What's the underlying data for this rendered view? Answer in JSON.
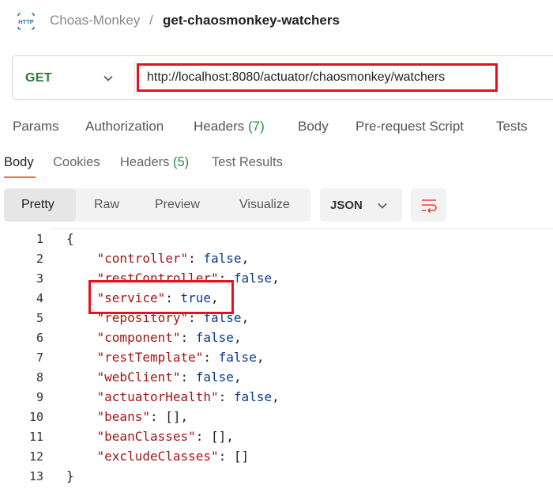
{
  "header": {
    "icon": "http-icon",
    "icon_text": "HTTP",
    "collection": "Choas-Monkey",
    "separator": "/",
    "request_name": "get-chaosmonkey-watchers"
  },
  "request": {
    "method": "GET",
    "url": "http://localhost:8080/actuator/chaosmonkey/watchers"
  },
  "request_tabs": [
    {
      "label": "Params"
    },
    {
      "label": "Authorization"
    },
    {
      "label": "Headers",
      "count": "(7)"
    },
    {
      "label": "Body"
    },
    {
      "label": "Pre-request Script"
    },
    {
      "label": "Tests"
    }
  ],
  "response_tabs": [
    {
      "label": "Body",
      "active": true
    },
    {
      "label": "Cookies"
    },
    {
      "label": "Headers",
      "count": "(5)"
    },
    {
      "label": "Test Results"
    }
  ],
  "view_modes": [
    "Pretty",
    "Raw",
    "Preview",
    "Visualize"
  ],
  "active_view_mode": "Pretty",
  "format": "JSON",
  "code": {
    "line_numbers": [
      "1",
      "2",
      "3",
      "4",
      "5",
      "6",
      "7",
      "8",
      "9",
      "10",
      "11",
      "12",
      "13"
    ],
    "open_brace": "{",
    "close_brace": "}",
    "entries": [
      {
        "key": "\"controller\"",
        "value": "false",
        "tail": ","
      },
      {
        "key": "\"restController\"",
        "value": "false",
        "tail": ","
      },
      {
        "key": "\"service\"",
        "value": "true",
        "tail": ","
      },
      {
        "key": "\"repository\"",
        "value": "false",
        "tail": ","
      },
      {
        "key": "\"component\"",
        "value": "false",
        "tail": ","
      },
      {
        "key": "\"restTemplate\"",
        "value": "false",
        "tail": ","
      },
      {
        "key": "\"webClient\"",
        "value": "false",
        "tail": ","
      },
      {
        "key": "\"actuatorHealth\"",
        "value": "false",
        "tail": ","
      },
      {
        "key": "\"beans\"",
        "value": "[]",
        "tail": ","
      },
      {
        "key": "\"beanClasses\"",
        "value": "[]",
        "tail": ","
      },
      {
        "key": "\"excludeClasses\"",
        "value": "[]",
        "tail": ""
      }
    ]
  },
  "colors": {
    "accent": "#ff6c37",
    "method_get": "#2b7a3b",
    "highlight_box": "#e8101e",
    "json_key": "#a31515",
    "json_value": "#0b3a8c"
  }
}
